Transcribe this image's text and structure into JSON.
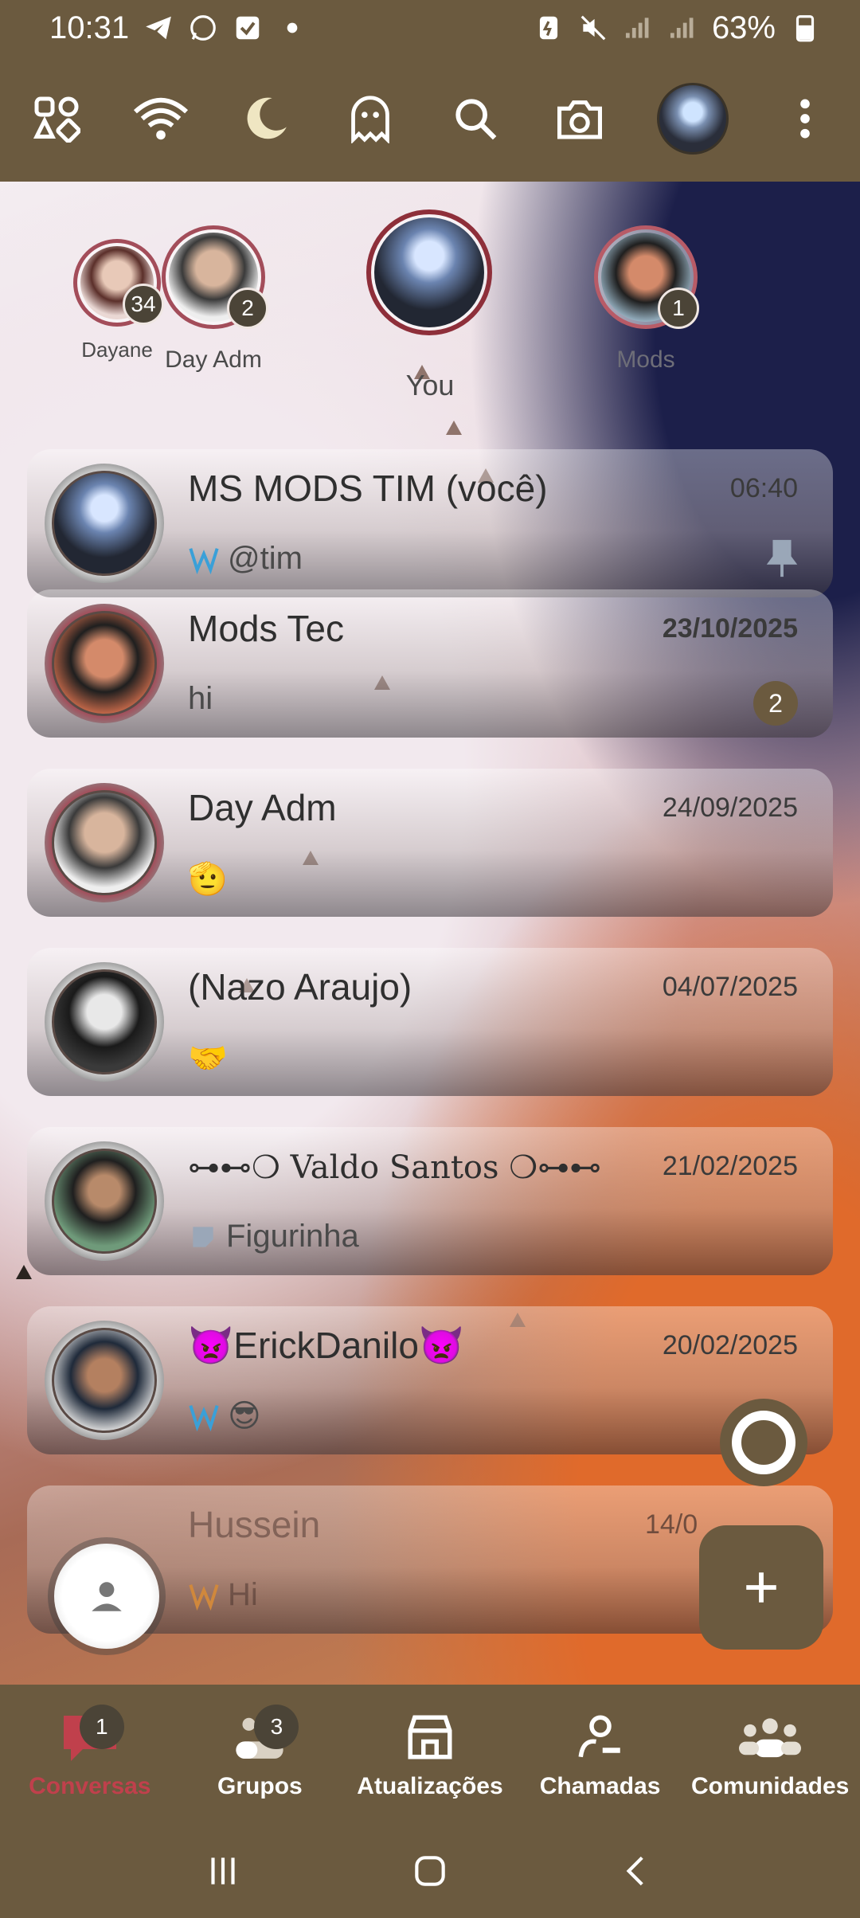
{
  "statusbar": {
    "time": "10:31",
    "battery": "63%"
  },
  "toolbar": {
    "icons": [
      "apps-icon",
      "wifi-icon",
      "moon-icon",
      "ghost-icon",
      "search-icon",
      "camera-icon",
      "profile-avatar",
      "more-vert-icon"
    ]
  },
  "stories": [
    {
      "name": "Dayane",
      "count": "34"
    },
    {
      "name": "Day Adm",
      "count": "2"
    },
    {
      "name": "You",
      "count": ""
    },
    {
      "name": "Mods",
      "count": "1"
    }
  ],
  "chats": [
    {
      "title": "MS MODS TIM (você)",
      "time": "06:40",
      "message": "@tim",
      "badge": "",
      "bold_time": false
    },
    {
      "title": "Mods Tec",
      "time": "23/10/2025",
      "message": "hi",
      "badge": "2",
      "bold_time": true
    },
    {
      "title": "Day Adm",
      "time": "24/09/2025",
      "message": "🫡",
      "badge": "",
      "bold_time": false
    },
    {
      "title": "(Nazo Araujo)",
      "time": "04/07/2025",
      "message": "🤝",
      "badge": "",
      "bold_time": false
    },
    {
      "title": "⊶⊷❍ Valdo Santos ❍⊶⊷",
      "time": "21/02/2025",
      "message": "Figurinha",
      "badge": "",
      "bold_time": false
    },
    {
      "title": "👿ErickDanilo👿",
      "time": "20/02/2025",
      "message": "😎",
      "badge": "",
      "bold_time": false
    },
    {
      "title": "Hussein",
      "time": "14/0",
      "message": "Hi",
      "badge": "",
      "bold_time": false
    }
  ],
  "bottomnav": [
    {
      "label": "Conversas",
      "badge": "1",
      "icon": "chat-icon"
    },
    {
      "label": "Grupos",
      "badge": "3",
      "icon": "groups-icon"
    },
    {
      "label": "Atualizações",
      "badge": "",
      "icon": "store-icon"
    },
    {
      "label": "Chamadas",
      "badge": "",
      "icon": "calls-icon"
    },
    {
      "label": "Comunidades",
      "badge": "",
      "icon": "communities-icon"
    }
  ],
  "colors": {
    "toolbar_bg": "#6b5a3f",
    "active_tab": "#c0404c",
    "badge_bg": "#4b4437"
  }
}
